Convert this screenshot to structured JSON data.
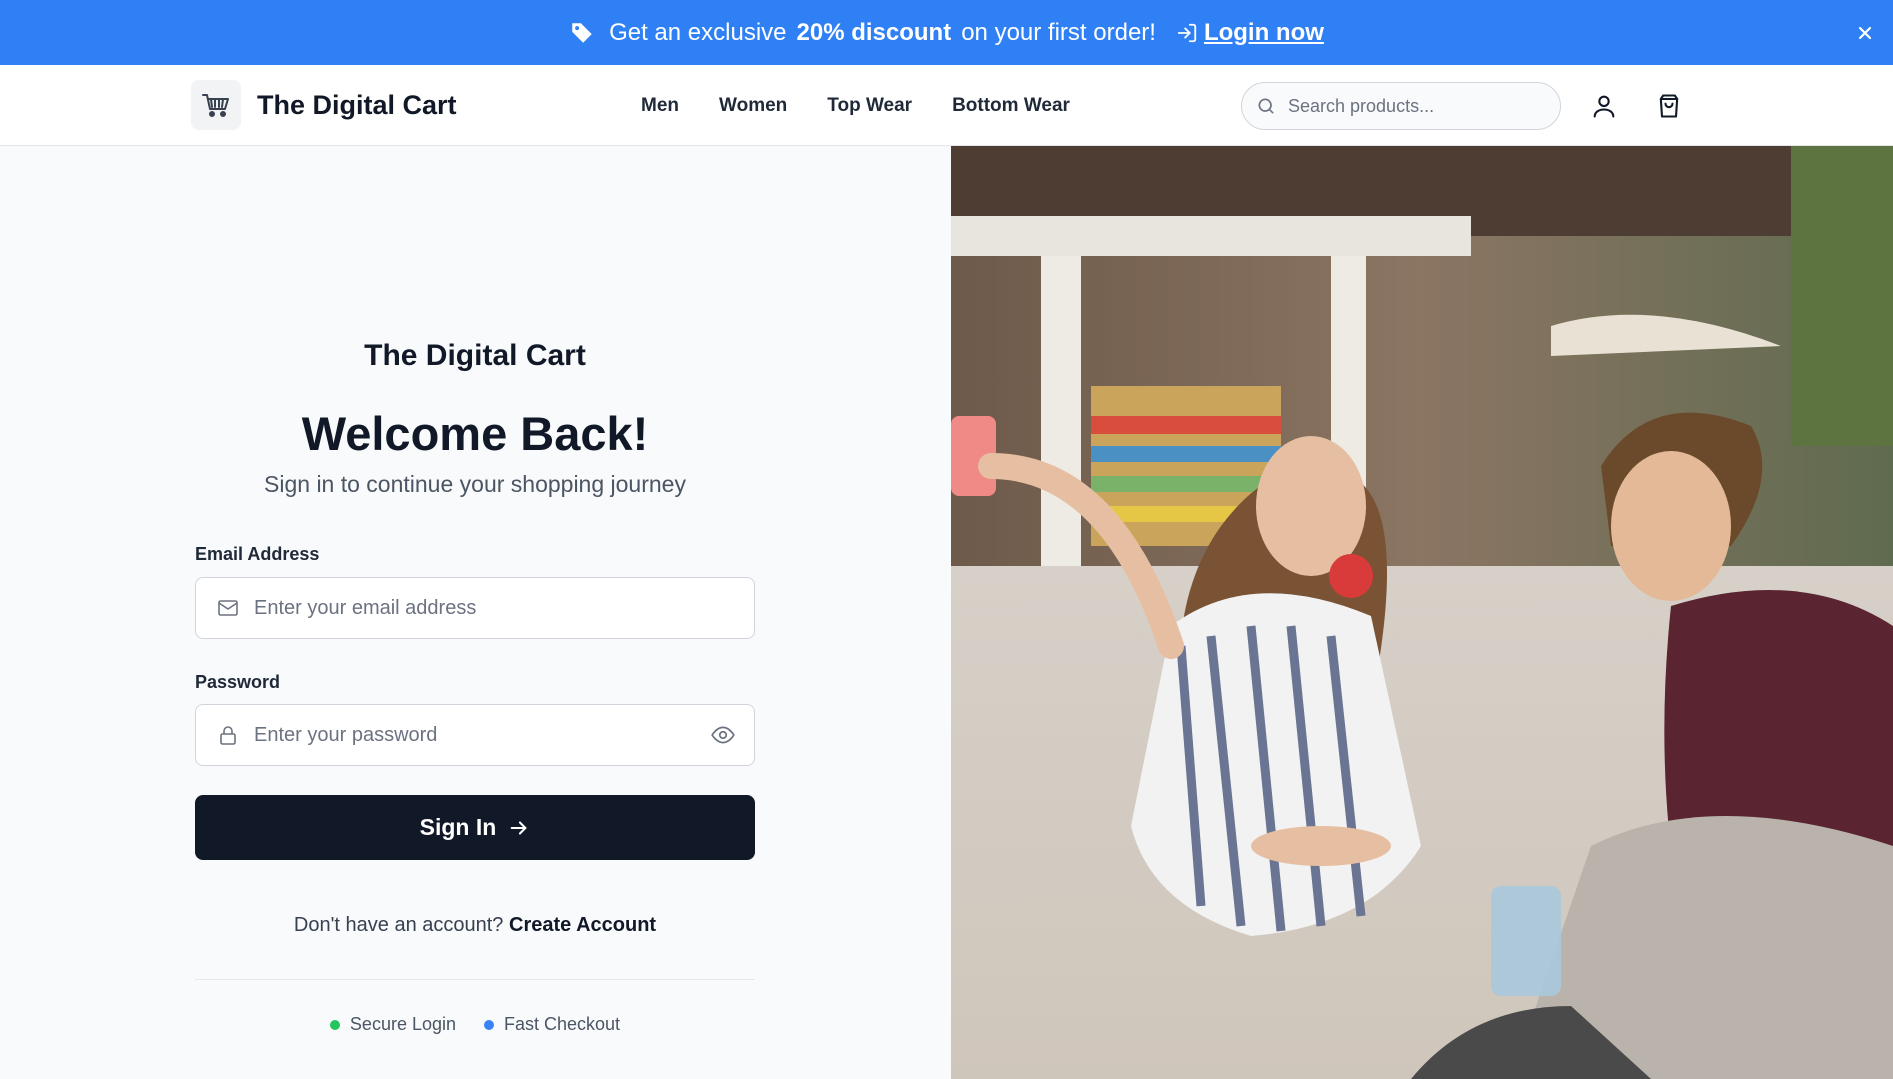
{
  "promo": {
    "lead": "Get an exclusive",
    "highlight": "20% discount",
    "trail": "on your first order!",
    "login_label": "Login now",
    "icon": "tag-icon",
    "close_icon": "close-icon",
    "color": "#2f80f5"
  },
  "header": {
    "brand": "The Digital Cart",
    "logo_icon": "shopping-cart-icon",
    "nav": [
      {
        "label": "Men"
      },
      {
        "label": "Women"
      },
      {
        "label": "Top Wear"
      },
      {
        "label": "Bottom Wear"
      }
    ],
    "search_placeholder": "Search products...",
    "user_icon": "user-icon",
    "bag_icon": "shopping-bag-icon"
  },
  "login": {
    "brand": "The Digital Cart",
    "title": "Welcome Back!",
    "subtitle": "Sign in to continue your shopping journey",
    "email_label": "Email Address",
    "email_placeholder": "Enter your email address",
    "password_label": "Password",
    "password_placeholder": "Enter your password",
    "submit_label": "Sign In",
    "no_account_text": "Don't have an account?",
    "create_label": "Create Account",
    "badges": [
      {
        "label": "Secure Login",
        "color": "#22c55e"
      },
      {
        "label": "Fast Checkout",
        "color": "#3b82f6"
      }
    ],
    "button_color": "#111827"
  }
}
